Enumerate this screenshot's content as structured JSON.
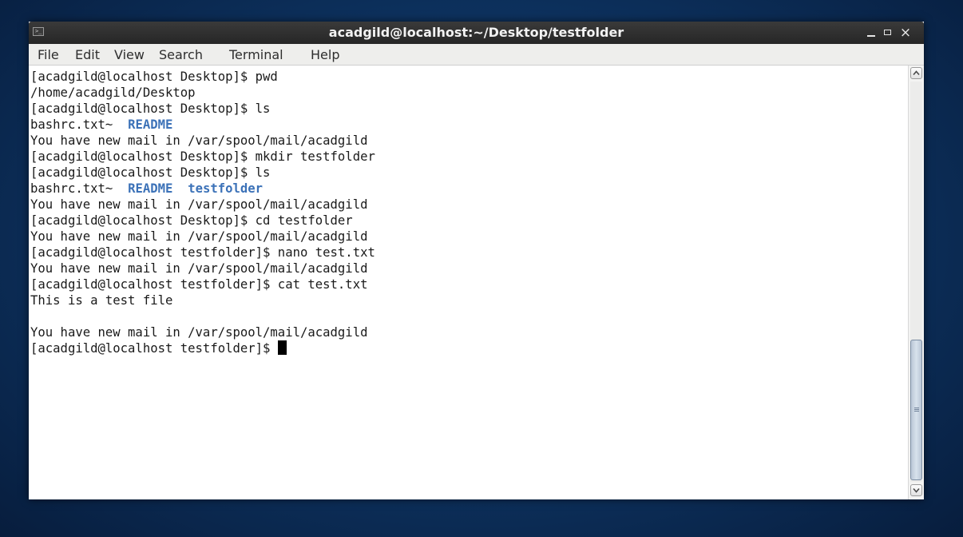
{
  "window": {
    "title": "acadgild@localhost:~/Desktop/testfolder",
    "controls": {
      "minimize": "_",
      "maximize": "□",
      "close": "×"
    }
  },
  "menu": {
    "items": [
      "File",
      "Edit",
      "View",
      "Search",
      "Terminal",
      "Help"
    ]
  },
  "terminal": {
    "lines": [
      {
        "prompt": "[acadgild@localhost Desktop]$ pwd"
      },
      {
        "text": "/home/acadgild/Desktop"
      },
      {
        "prompt": "[acadgild@localhost Desktop]$ ls"
      },
      {
        "text": "bashrc.txt~  ",
        "dirs": [
          "README"
        ]
      },
      {
        "text": "You have new mail in /var/spool/mail/acadgild"
      },
      {
        "prompt": "[acadgild@localhost Desktop]$ mkdir testfolder"
      },
      {
        "prompt": "[acadgild@localhost Desktop]$ ls"
      },
      {
        "text": "bashrc.txt~  ",
        "dirs": [
          "README",
          "testfolder"
        ]
      },
      {
        "text": "You have new mail in /var/spool/mail/acadgild"
      },
      {
        "prompt": "[acadgild@localhost Desktop]$ cd testfolder"
      },
      {
        "text": "You have new mail in /var/spool/mail/acadgild"
      },
      {
        "prompt": "[acadgild@localhost testfolder]$ nano test.txt"
      },
      {
        "text": "You have new mail in /var/spool/mail/acadgild"
      },
      {
        "prompt": "[acadgild@localhost testfolder]$ cat test.txt"
      },
      {
        "text": "This is a test file"
      },
      {
        "text": ""
      },
      {
        "text": "You have new mail in /var/spool/mail/acadgild"
      },
      {
        "prompt": "[acadgild@localhost testfolder]$ ",
        "cursor": true
      }
    ],
    "colors": {
      "background": "#ffffff",
      "foreground": "#1a1a1a",
      "directory": "#3c72b8"
    }
  },
  "icons": {
    "window_icon": "terminal-icon",
    "scroll_up": "chevron-up-icon",
    "scroll_down": "chevron-down-icon"
  }
}
